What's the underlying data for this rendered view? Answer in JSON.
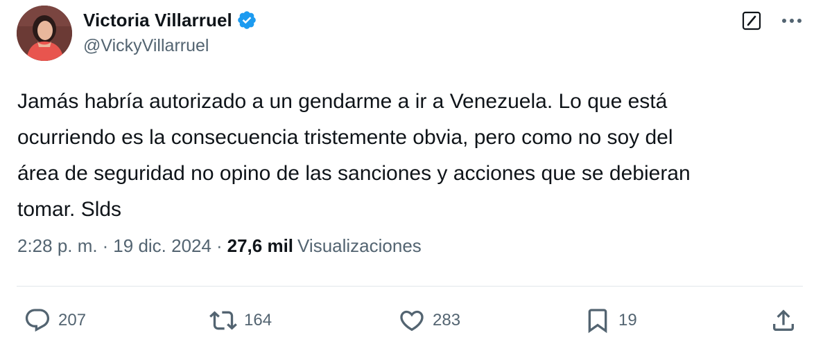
{
  "author": {
    "display_name": "Victoria Villarruel",
    "handle": "@VickyVillarruel",
    "verified": true
  },
  "post": {
    "text": "Jamás habría autorizado a un gendarme a ir a Venezuela. Lo que está\nocurriendo es la consecuencia tristemente obvia, pero como no soy del\nárea de seguridad no opino de las sanciones y acciones que se debieran\ntomar. Slds",
    "time": "2:28 p. m.",
    "separator": "·",
    "date": "19 dic. 2024",
    "views_count": "27,6 mil",
    "views_label": "Visualizaciones"
  },
  "actions": {
    "replies": "207",
    "reposts": "164",
    "likes": "283",
    "bookmarks": "19"
  },
  "icons": {
    "top_right": [
      "grok-icon",
      "more-icon"
    ],
    "action_bar": [
      "reply-icon",
      "repost-icon",
      "like-icon",
      "bookmark-icon",
      "share-icon"
    ]
  },
  "colors": {
    "text_primary": "#0f1419",
    "text_secondary": "#536471",
    "verified_blue": "#1d9bf0",
    "divider": "#e1e6ea"
  }
}
